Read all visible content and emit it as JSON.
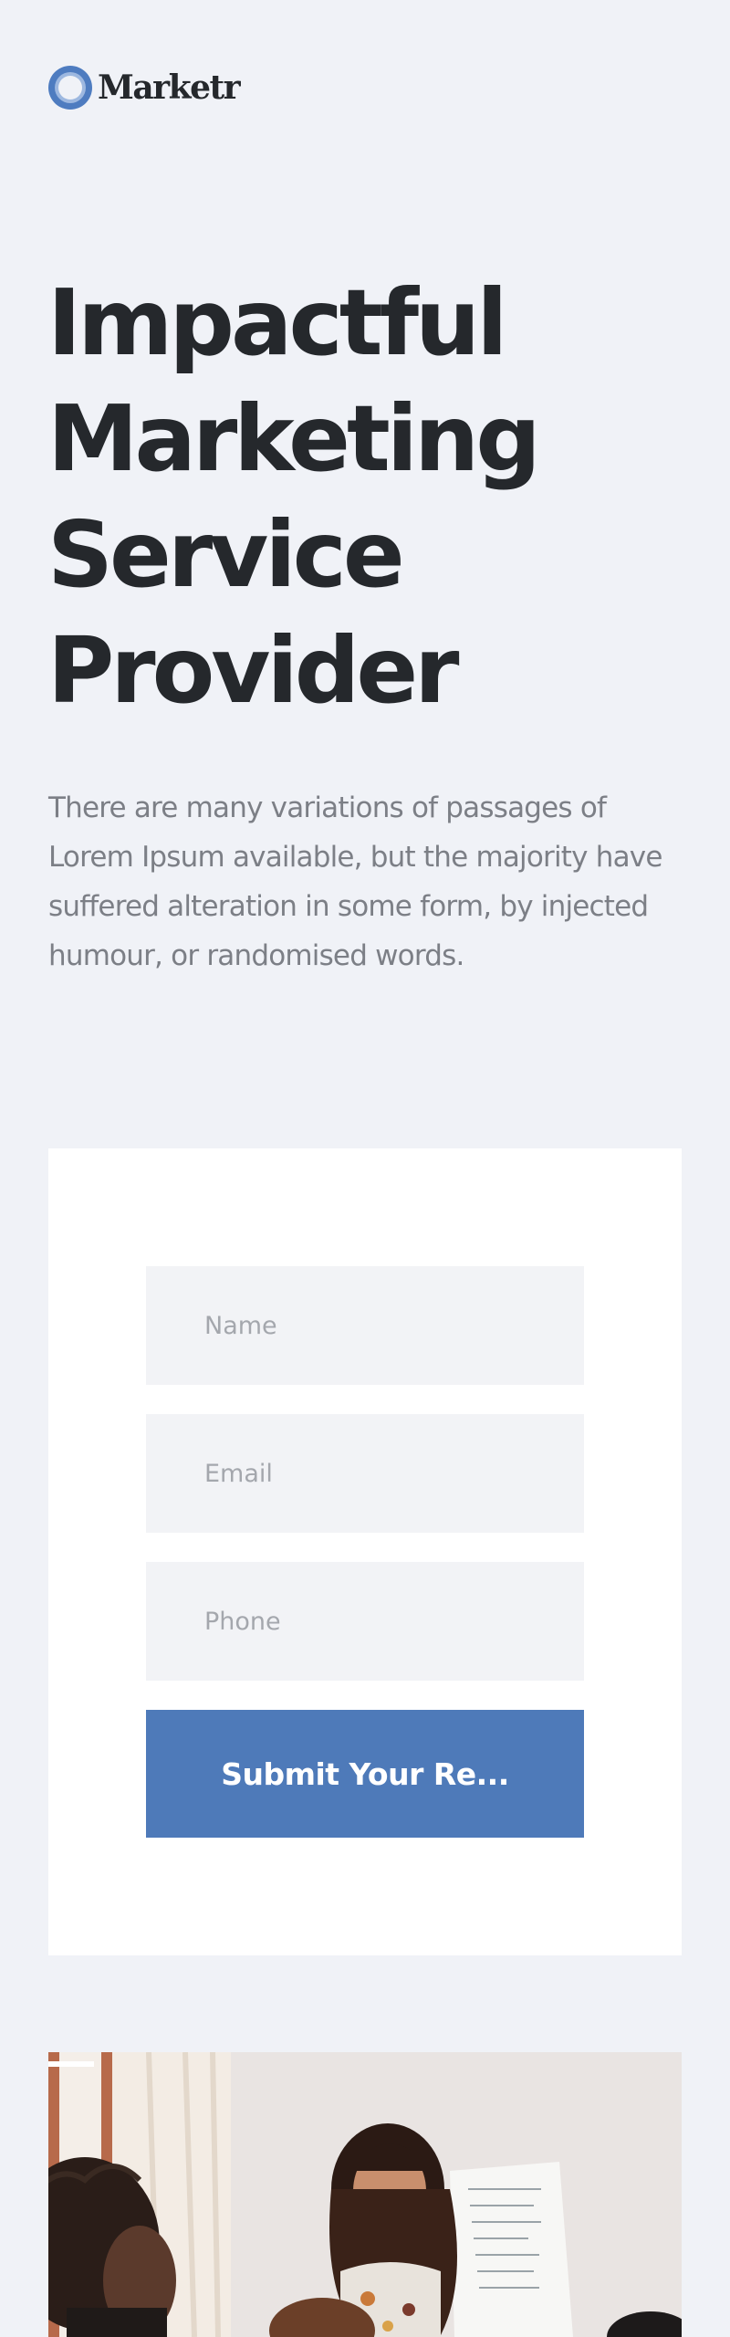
{
  "brand": {
    "name": "Marketr"
  },
  "hero": {
    "title_lines": [
      "Impactful",
      "Marketing",
      "Service",
      "Provider"
    ],
    "text": "There are many variations of passages of Lorem Ipsum available, but the majority have suffered alteration in some form, by injected humour, or randomised words."
  },
  "form": {
    "name_placeholder": "Name",
    "email_placeholder": "Email",
    "phone_placeholder": "Phone",
    "submit_label": "Submit Your Re..."
  },
  "colors": {
    "background": "#f0f2f7",
    "accent": "#4e7ab9",
    "heading": "#25282c",
    "body_text": "#7c7f86"
  }
}
